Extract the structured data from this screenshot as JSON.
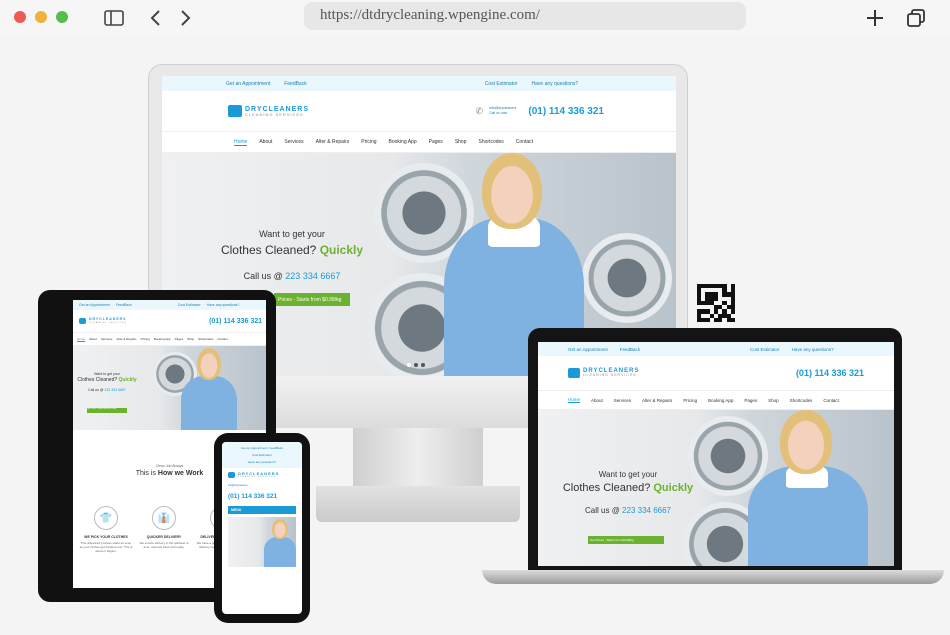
{
  "browser": {
    "url": "https://dtdrycleaning.wpengine.com/",
    "traffic_colors": [
      "#ee5b54",
      "#f0b23a",
      "#53bf4a"
    ]
  },
  "site": {
    "topbar": {
      "appointment": "Get an Appointment",
      "feedback": "FeedBack",
      "cost": "Cost Estimator",
      "question": "Have any questions?"
    },
    "logo_title": "DRYCLEANERS",
    "logo_sub": "CLEANING SERVICES",
    "phone_note_line1": "info@drycleaners",
    "phone_note_line2": "Call us now",
    "phone": "(01) 114 336 321",
    "nav": [
      "Home",
      "About",
      "Services",
      "Alter & Repairs",
      "Pricing",
      "Booking App",
      "Pages",
      "Shop",
      "Shortcodes",
      "Contact"
    ],
    "hero_line1": "Want to get your",
    "hero_line2a": "Clothes Cleaned?",
    "hero_line2b": "Quickly",
    "hero_call": "Call us @",
    "hero_call_number": "223 334 6667",
    "hero_button": "Get Prices - Starts from $0.99/kg",
    "hero_button_cut": "Prices - Starts from $0.99/kg",
    "menu_label": "MENU",
    "how_small": "Clean Job Always",
    "how_title": "This is",
    "how_title_b": "How we Work",
    "features": [
      {
        "title": "WE PICK YOUR CLOTHES",
        "text": "This advanced process starts as soon as your clothes get handed over. This is where it begins."
      },
      {
        "title": "QUICKER DELIVERY",
        "text": "We ensure delivery in the quickest of time, returned fresh and ready."
      },
      {
        "title": "DELIVERY AT DOORSTEP",
        "text": "We have a great team serving all your delivery needs as fast as possible."
      }
    ]
  }
}
